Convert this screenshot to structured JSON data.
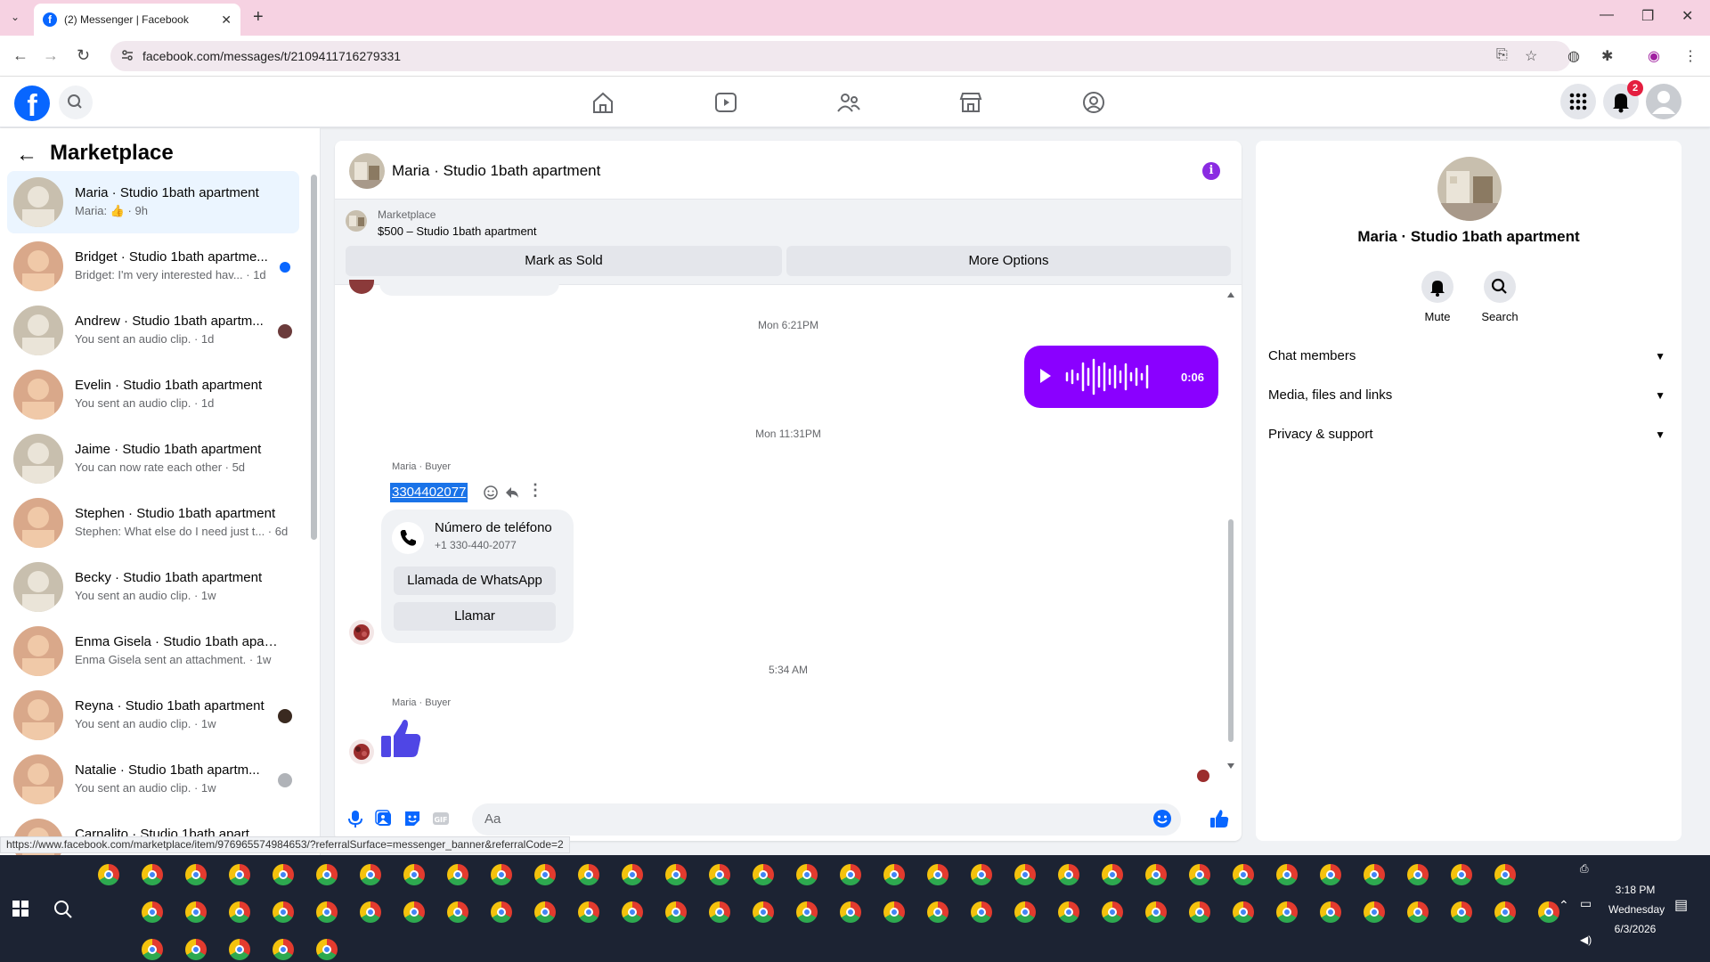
{
  "browser": {
    "tab_title": "(2) Messenger | Facebook",
    "url": "facebook.com/messages/t/2109411716279331",
    "status_url": "https://www.facebook.com/marketplace/item/976965574984653/?referralSurface=messenger_banner&referralCode=2"
  },
  "header": {
    "notification_count": "2"
  },
  "sidebar": {
    "title": "Marketplace",
    "conversations": [
      {
        "name": "Maria · Studio 1bath apartment",
        "preview": "Maria: 👍 · 9h",
        "active": true
      },
      {
        "name": "Bridget · Studio 1bath apartme...",
        "preview": "Bridget: I'm very interested hav... · 1d",
        "unread": true
      },
      {
        "name": "Andrew · Studio 1bath apartm...",
        "preview": "You sent an audio clip. · 1d"
      },
      {
        "name": "Evelin · Studio 1bath apartment",
        "preview": "You sent an audio clip. · 1d"
      },
      {
        "name": "Jaime · Studio 1bath apartment",
        "preview": "You can now rate each other · 5d"
      },
      {
        "name": "Stephen · Studio 1bath apartment",
        "preview": "Stephen: What else do I need just t... · 6d"
      },
      {
        "name": "Becky · Studio 1bath apartment",
        "preview": "You sent an audio clip. · 1w"
      },
      {
        "name": "Enma Gisela · Studio 1bath apart...",
        "preview": "Enma Gisela sent an attachment. · 1w"
      },
      {
        "name": "Reyna · Studio 1bath apartment",
        "preview": "You sent an audio clip. · 1w"
      },
      {
        "name": "Natalie · Studio 1bath apartm...",
        "preview": "You sent an audio clip. · 1w"
      },
      {
        "name": "Carnalito · Studio 1bath apart...",
        "preview": ""
      }
    ]
  },
  "chat": {
    "title": "Maria · Studio 1bath apartment",
    "banner_label": "Marketplace",
    "banner_item": "$500 – Studio 1bath apartment",
    "mark_sold": "Mark as Sold",
    "more_options": "More Options",
    "time1": "Mon 6:21PM",
    "audio_duration": "0:06",
    "time2": "Mon 11:31PM",
    "sender1": "Maria · Buyer",
    "phone_text": "3304402077",
    "phone_card_title": "Número de teléfono",
    "phone_card_number": "+1 330-440-2077",
    "whatsapp_button": "Llamada de WhatsApp",
    "call_button": "Llamar",
    "time3": "5:34 AM",
    "sender2": "Maria · Buyer",
    "input_placeholder": "Aa"
  },
  "info": {
    "name": "Maria · Studio 1bath apartment",
    "mute": "Mute",
    "search": "Search",
    "sections": [
      "Chat members",
      "Media, files and links",
      "Privacy & support"
    ]
  },
  "taskbar": {
    "time": "3:18 PM",
    "day": "Wednesday",
    "date": "6/3/2026"
  },
  "colors": {
    "fb_blue": "#0866ff",
    "accent_purple": "#8a00ff",
    "thumb_blue": "#4f46e5"
  }
}
